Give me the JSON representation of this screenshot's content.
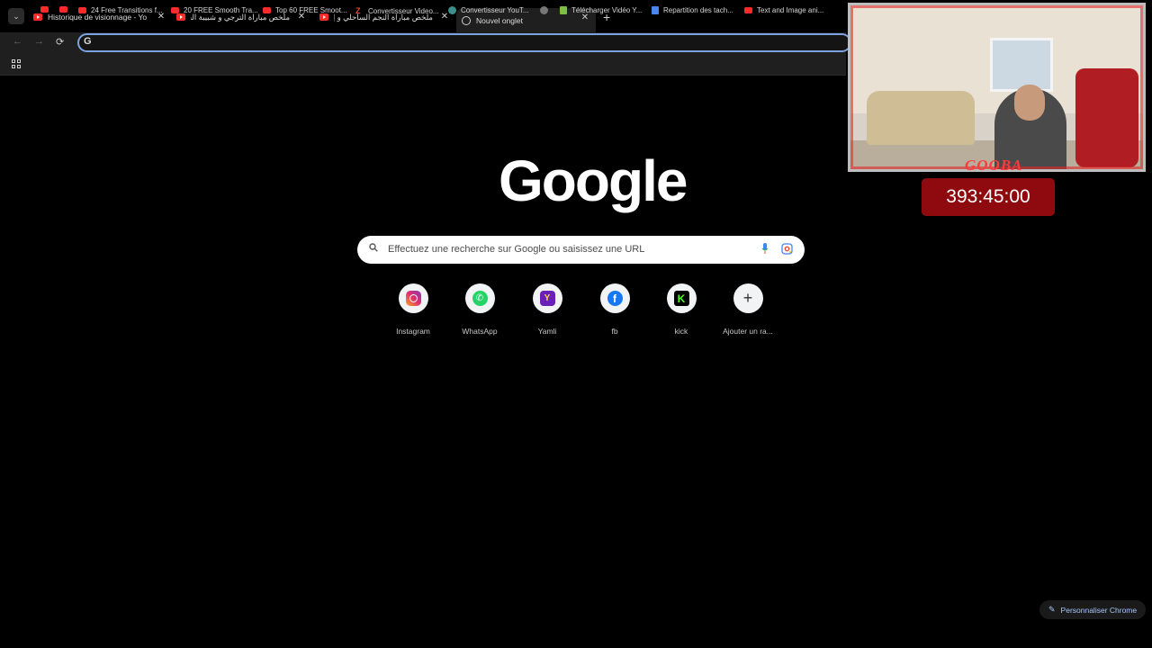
{
  "tabs": [
    {
      "title": "Historique de visionnage - YouTube",
      "active": false
    },
    {
      "title": "ملخص مباراة الترجي و شبيبة القبائل",
      "active": false
    },
    {
      "title": "ملخص مباراة النجم الساحلي و إتحاد",
      "active": false
    },
    {
      "title": "Nouvel onglet",
      "active": true
    }
  ],
  "toolbar": {
    "back": "←",
    "forward": "→",
    "reload": "⟳",
    "omnibox_value": ""
  },
  "bookmarks": [
    {
      "label": "",
      "icon": "youtube-icon"
    },
    {
      "label": "",
      "icon": "youtube-icon"
    },
    {
      "label": "24 Free Transitions f...",
      "icon": "youtube-icon"
    },
    {
      "label": "20 FREE Smooth Tra...",
      "icon": "youtube-icon"
    },
    {
      "label": "Top 60 FREE Smoot...",
      "icon": "youtube-icon"
    },
    {
      "label": "Convertisseur Video...",
      "icon": "z-icon"
    },
    {
      "label": "Convertisseur YouT...",
      "icon": "converter-icon"
    },
    {
      "label": "",
      "icon": "globe-icon"
    },
    {
      "label": "Télécharger Vidéo Y...",
      "icon": "download-icon"
    },
    {
      "label": "Repartition des tach...",
      "icon": "document-icon"
    },
    {
      "label": "Text and Image ani...",
      "icon": "youtube-icon"
    }
  ],
  "logo": "Google",
  "search": {
    "placeholder": "Effectuez une recherche sur Google ou saisissez une URL"
  },
  "shortcuts": [
    {
      "label": "Instagram",
      "icon": "instagram-icon"
    },
    {
      "label": "WhatsApp",
      "icon": "whatsapp-icon"
    },
    {
      "label": "Yamli",
      "icon": "yamli-icon"
    },
    {
      "label": "fb",
      "icon": "facebook-icon"
    },
    {
      "label": "kick",
      "icon": "kick-icon"
    },
    {
      "label": "Ajouter un ra...",
      "icon": "plus-icon"
    }
  ],
  "overlay": {
    "cam_label": "GOOBA",
    "timer": "393:45:00"
  },
  "customize_label": "Personnaliser Chrome",
  "colors": {
    "accent": "#a8c7fa",
    "timer_bg": "#8e0a0f",
    "omnibox_focus": "#7ca2e0"
  }
}
